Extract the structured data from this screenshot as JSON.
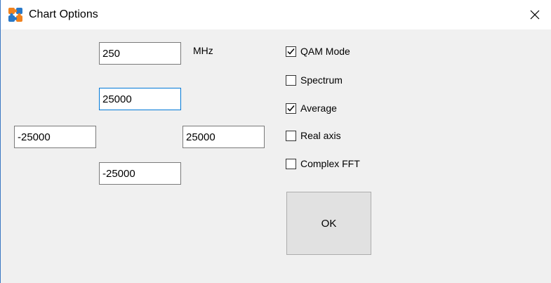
{
  "window": {
    "title": "Chart Options",
    "app_icon": "puzzle-pieces-icon",
    "close_icon": "close-icon"
  },
  "fields": {
    "frequency": "250",
    "frequency_unit": "MHz",
    "y_max": "25000",
    "x_min": "-25000",
    "x_max": "25000",
    "y_min": "-25000"
  },
  "options": [
    {
      "label": "QAM Mode",
      "checked": true
    },
    {
      "label": "Spectrum",
      "checked": false
    },
    {
      "label": "Average",
      "checked": true
    },
    {
      "label": "Real axis",
      "checked": false
    },
    {
      "label": "Complex FFT",
      "checked": false
    }
  ],
  "ok_label": "OK",
  "colors": {
    "window_border": "#3c78c3",
    "focus_border": "#0078d7",
    "dialog_bg": "#f0f0f0",
    "icon_orange": "#f0821e",
    "icon_blue": "#2878c8"
  }
}
